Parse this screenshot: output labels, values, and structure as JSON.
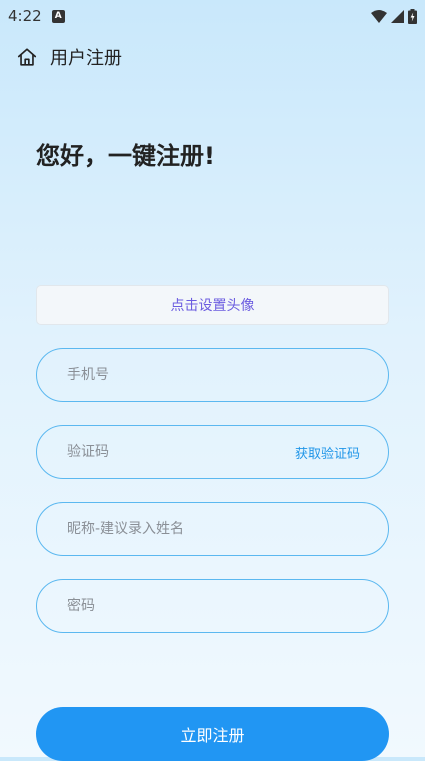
{
  "status_bar": {
    "time": "4:22",
    "notification_icon": "A",
    "icons": [
      "wifi-icon",
      "signal-icon",
      "battery-charging-icon"
    ]
  },
  "nav": {
    "title": "用户注册",
    "home_icon": "home-icon"
  },
  "greeting": "您好，一键注册!",
  "avatar_button_label": "点击设置头像",
  "fields": {
    "phone": {
      "placeholder": "手机号",
      "value": ""
    },
    "code": {
      "placeholder": "验证码",
      "value": "",
      "action_label": "获取验证码"
    },
    "nickname": {
      "placeholder": "昵称-建议录入姓名",
      "value": ""
    },
    "password": {
      "placeholder": "密码",
      "value": ""
    }
  },
  "submit_label": "立即注册",
  "colors": {
    "accent": "#2196f3",
    "field_border": "#5bb8f0",
    "avatar_label": "#6b5ce0"
  }
}
